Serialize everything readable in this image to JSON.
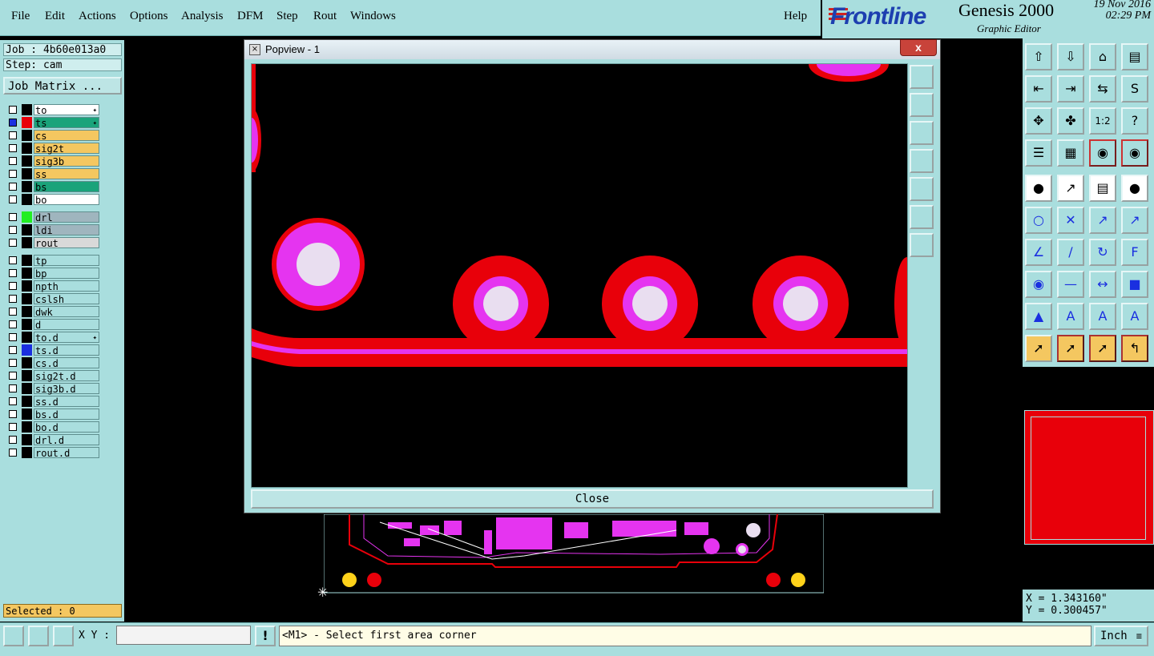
{
  "menu": {
    "items": [
      "File",
      "Edit",
      "Actions",
      "Options",
      "Analysis",
      "DFM",
      "Step",
      "Rout",
      "Windows"
    ],
    "help": "Help"
  },
  "branding": {
    "logo": "Frontline",
    "title": "Genesis 2000",
    "subtitle": "Graphic Editor",
    "date": "19 Nov 2016",
    "time": "02:29 PM"
  },
  "job": {
    "job_label": "Job : 4b60e013a0",
    "step_label": "Step: cam",
    "matrix_button": "Job Matrix ..."
  },
  "layers": [
    {
      "name": "to",
      "bg": "#ffffff",
      "swatch": "#000000",
      "mark": "✦"
    },
    {
      "name": "ts",
      "bg": "#1aa37a",
      "swatch": "#e8000a",
      "mark": "✦",
      "selected": true
    },
    {
      "name": "cs",
      "bg": "#f4c760",
      "swatch": "#000000",
      "mark": ""
    },
    {
      "name": "sig2t",
      "bg": "#f4c760",
      "swatch": "#000000",
      "mark": ""
    },
    {
      "name": "sig3b",
      "bg": "#f4c760",
      "swatch": "#000000",
      "mark": ""
    },
    {
      "name": "ss",
      "bg": "#f4c760",
      "swatch": "#000000",
      "mark": ""
    },
    {
      "name": "bs",
      "bg": "#1aa37a",
      "swatch": "#000000",
      "mark": ""
    },
    {
      "name": "bo",
      "bg": "#ffffff",
      "swatch": "#000000",
      "mark": ""
    },
    {
      "name": "drl",
      "bg": "#9fb5be",
      "swatch": "#22ee22",
      "mark": ""
    },
    {
      "name": "ldi",
      "bg": "#9fb5be",
      "swatch": "#000000",
      "mark": ""
    },
    {
      "name": "rout",
      "bg": "#d9d9d9",
      "swatch": "#000000",
      "mark": ""
    },
    {
      "name": "tp",
      "bg": "#a9dede",
      "swatch": "#000000",
      "mark": ""
    },
    {
      "name": "bp",
      "bg": "#a9dede",
      "swatch": "#000000",
      "mark": ""
    },
    {
      "name": "npth",
      "bg": "#a9dede",
      "swatch": "#000000",
      "mark": ""
    },
    {
      "name": "cslsh",
      "bg": "#a9dede",
      "swatch": "#000000",
      "mark": ""
    },
    {
      "name": "dwk",
      "bg": "#a9dede",
      "swatch": "#000000",
      "mark": ""
    },
    {
      "name": "d",
      "bg": "#a9dede",
      "swatch": "#000000",
      "mark": ""
    },
    {
      "name": "to.d",
      "bg": "#a9dede",
      "swatch": "#000000",
      "mark": "✦"
    },
    {
      "name": "ts.d",
      "bg": "#a9dede",
      "swatch": "#1a2fe0",
      "mark": ""
    },
    {
      "name": "cs.d",
      "bg": "#a9dede",
      "swatch": "#000000",
      "mark": ""
    },
    {
      "name": "sig2t.d",
      "bg": "#a9dede",
      "swatch": "#000000",
      "mark": ""
    },
    {
      "name": "sig3b.d",
      "bg": "#a9dede",
      "swatch": "#000000",
      "mark": ""
    },
    {
      "name": "ss.d",
      "bg": "#a9dede",
      "swatch": "#000000",
      "mark": ""
    },
    {
      "name": "bs.d",
      "bg": "#a9dede",
      "swatch": "#000000",
      "mark": ""
    },
    {
      "name": "bo.d",
      "bg": "#a9dede",
      "swatch": "#000000",
      "mark": ""
    },
    {
      "name": "drl.d",
      "bg": "#a9dede",
      "swatch": "#000000",
      "mark": ""
    },
    {
      "name": "rout.d",
      "bg": "#a9dede",
      "swatch": "#000000",
      "mark": ""
    }
  ],
  "selected_label": "Selected : 0",
  "popview": {
    "title": "Popview - 1",
    "close_x": "x",
    "close_button": "Close"
  },
  "toolbar_icons": [
    "zoom-home-icon",
    "zoom-fit-icon",
    "home-icon",
    "window-icon",
    "pan-left-icon",
    "pan-right-icon",
    "mirror-icon",
    "s-curve-icon",
    "zoom-in-icon",
    "zoom-out-icon",
    "scale-icon",
    "help-icon",
    "measure-icon",
    "grid-icon",
    "snap-icon",
    "snap-alt-icon",
    "pad-icon",
    "line-icon",
    "ruler-icon",
    "circle-icon",
    "node-icon",
    "cross-icon",
    "point-icon",
    "point-alt-icon",
    "draw-line-icon",
    "draw-arc-icon",
    "rotate-icon",
    "flip-icon",
    "connect-icon",
    "minus-icon",
    "resize-icon",
    "shape-icon",
    "fill-icon",
    "outline-icon",
    "arc-icon",
    "arc-alt-icon",
    "select-icon",
    "select-box-icon",
    "select-circle-icon",
    "select-path-icon"
  ],
  "coords": {
    "x": "X = 1.343160\"",
    "y": "Y = 0.300457\""
  },
  "bottom": {
    "xy_label": "X Y :",
    "xy_value": "",
    "status": "<M1> - Select first area corner",
    "unit": "Inch",
    "warn": "!"
  },
  "colors": {
    "panel": "#a9dede",
    "copper": "#e8000a",
    "mask": "#e534f0",
    "drill": "#e9def0"
  }
}
